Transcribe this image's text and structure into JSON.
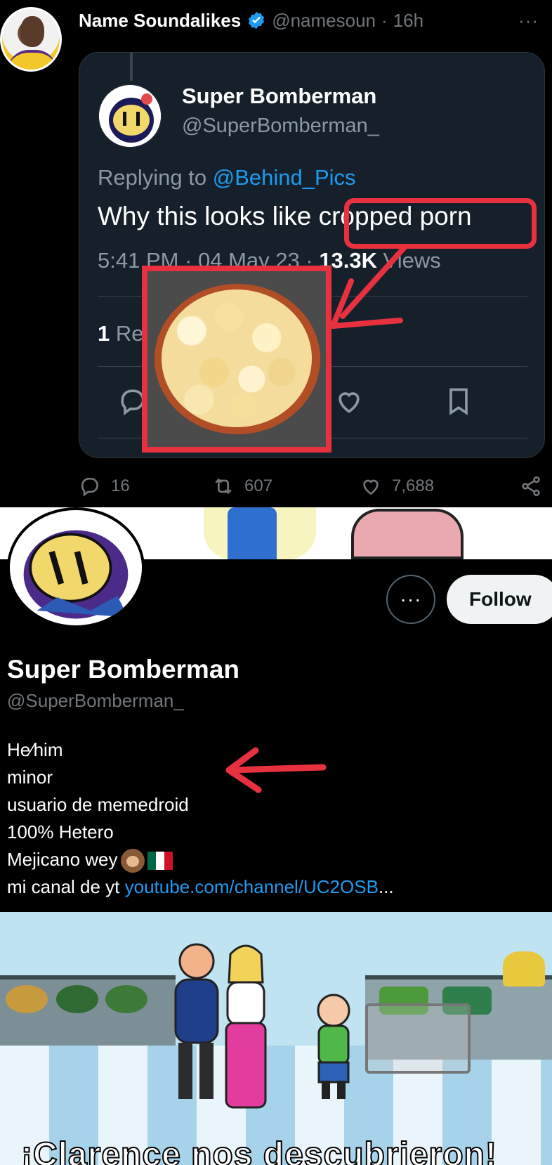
{
  "top_tweet": {
    "author_name": "Name Soundalikes",
    "author_handle": "@namesoun",
    "time_sep": "·",
    "time": "16h",
    "more": "···",
    "embed": {
      "name": "Super Bomberman",
      "handle": "@SuperBomberman_",
      "replying_prefix": "Replying to",
      "replying_mention": "@Behind_Pics",
      "text": "Why this looks like cropped porn",
      "time": "5:41 PM · 04 May 23 · ",
      "views_count": "13.3K",
      "views_label": " Views",
      "replies_count": "1",
      "replies_label": " Re"
    },
    "actions": {
      "reply": "16",
      "retweet": "607",
      "like": "7,688"
    }
  },
  "profile": {
    "more": "···",
    "follow": "Follow",
    "name": "Super Bomberman",
    "handle": "@SuperBomberman_",
    "bio": {
      "line1": "He⁄him",
      "line2": "minor",
      "line3": "usuario de memedroid",
      "line4": "100% Hetero",
      "line5": "Mejicano wey",
      "line6_prefix": "mi canal de yt ",
      "line6_link": "youtube.com/channel/UC2OSB",
      "line6_suffix": "..."
    }
  },
  "cartoon": {
    "caption": "¡Clarence nos descubrieron!"
  },
  "colors": {
    "accent": "#1d9bf0",
    "annotation_red": "#e8313f"
  }
}
